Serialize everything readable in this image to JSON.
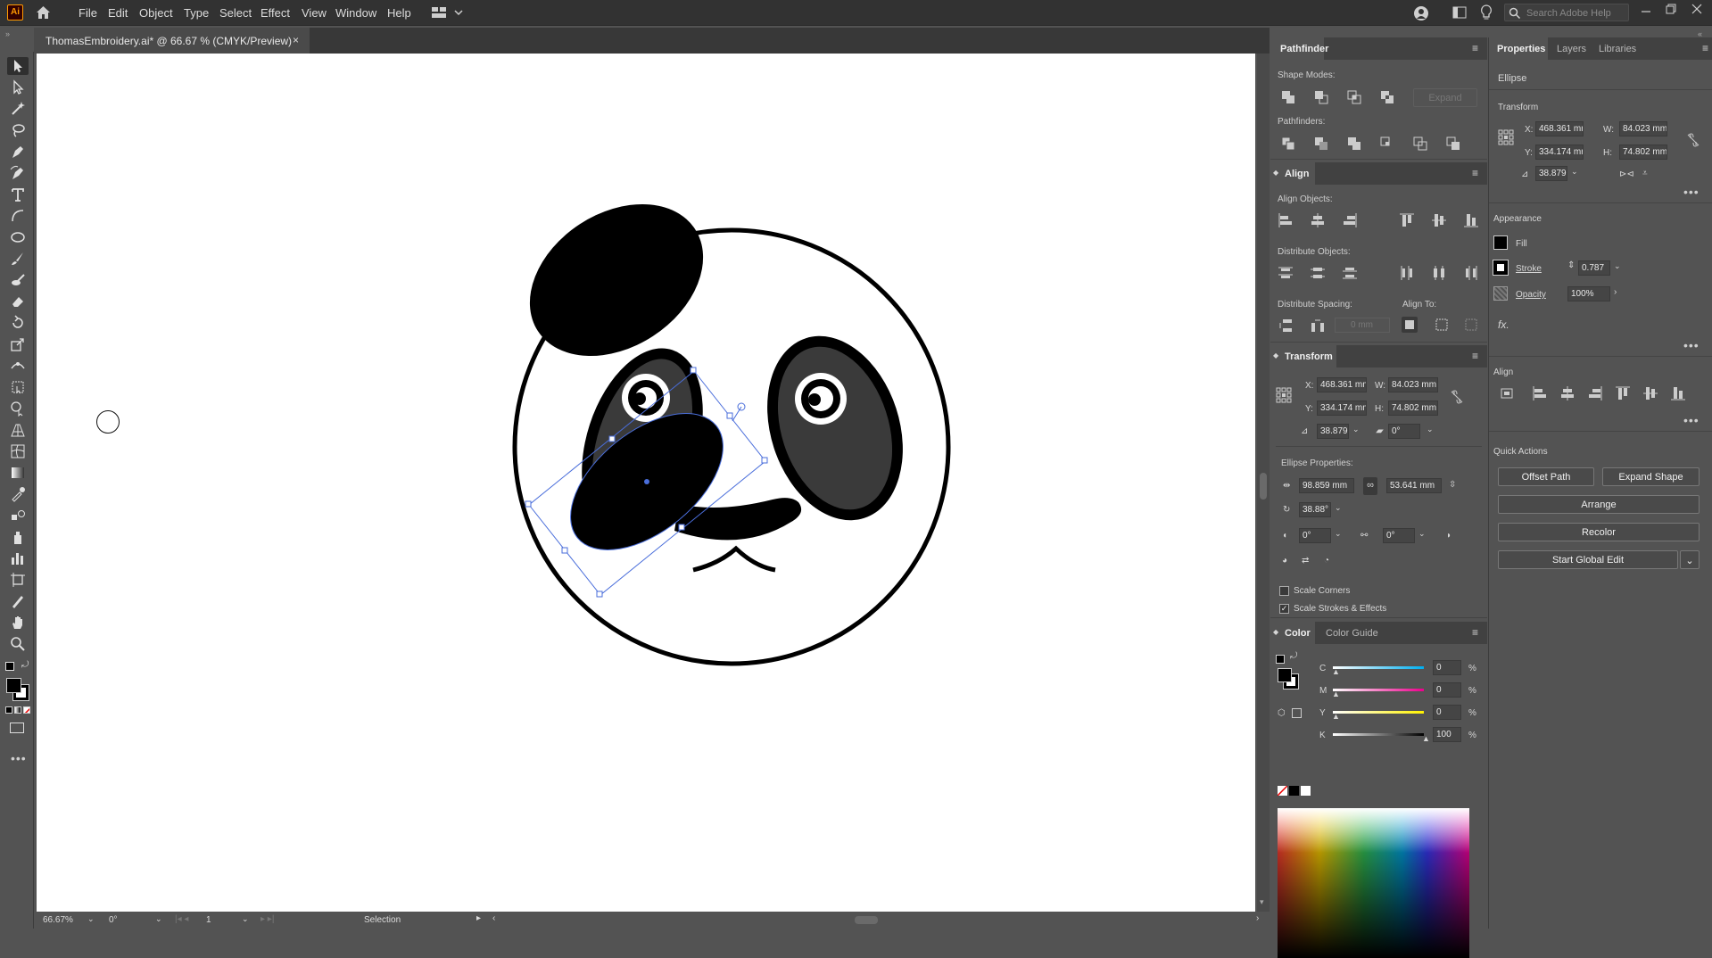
{
  "app": {
    "logo": "Ai",
    "brand_color": "#310000",
    "accent_color": "#ff9a00"
  },
  "menu": [
    "File",
    "Edit",
    "Object",
    "Type",
    "Select",
    "Effect",
    "View",
    "Window",
    "Help"
  ],
  "search": {
    "placeholder": "Search Adobe Help"
  },
  "document": {
    "tab_title": "ThomasEmbroidery.ai* @ 66.67 % (CMYK/Preview)"
  },
  "status": {
    "zoom": "66.67%",
    "rotation": "0°",
    "artboard": "1",
    "tool": "Selection"
  },
  "pathfinder": {
    "title": "Pathfinder",
    "shape_modes": "Shape Modes:",
    "expand": "Expand",
    "pathfinders": "Pathfinders:"
  },
  "align": {
    "title": "Align",
    "align_objects": "Align Objects:",
    "distribute_objects": "Distribute Objects:",
    "distribute_spacing": "Distribute Spacing:",
    "align_to": "Align To:",
    "spacing_value": "0 mm"
  },
  "transform": {
    "title": "Transform",
    "x_label": "X:",
    "x": "468.361 mm",
    "y_label": "Y:",
    "y": "334.174 mm",
    "w_label": "W:",
    "w": "84.023 mm",
    "h_label": "H:",
    "h": "74.802 mm",
    "angle": "38.879°",
    "shear": "0°",
    "ellipse_properties": "Ellipse Properties:",
    "ellipse_w": "98.859 mm",
    "ellipse_h": "53.641 mm",
    "ellipse_angle": "38.88°",
    "pie_start": "0°",
    "pie_end": "0°",
    "scale_corners": "Scale Corners",
    "scale_strokes": "Scale Strokes & Effects",
    "scale_corners_checked": false,
    "scale_strokes_checked": true
  },
  "color": {
    "title": "Color",
    "guide": "Color Guide",
    "channels": [
      {
        "label": "C",
        "value": "0"
      },
      {
        "label": "M",
        "value": "0"
      },
      {
        "label": "Y",
        "value": "0"
      },
      {
        "label": "K",
        "value": "100"
      }
    ],
    "unit": "%"
  },
  "properties": {
    "tabs": [
      "Properties",
      "Layers",
      "Libraries"
    ],
    "object_type": "Ellipse",
    "transform_title": "Transform",
    "x": "468.361 mr",
    "y": "334.174 mr",
    "w": "84.023 mm",
    "h": "74.802 mm",
    "angle": "38.879°",
    "appearance_title": "Appearance",
    "fill_label": "Fill",
    "stroke_label": "Stroke",
    "stroke_value": "0.787",
    "opacity_label": "Opacity",
    "opacity_value": "100%",
    "fx_label": "fx.",
    "align_title": "Align",
    "quick_actions_title": "Quick Actions",
    "offset_path": "Offset Path",
    "expand_shape": "Expand Shape",
    "arrange": "Arrange",
    "recolor": "Recolor",
    "global_edit": "Start Global Edit"
  },
  "tools": [
    "selection-tool",
    "direct-selection-tool",
    "magic-wand-tool",
    "lasso-tool",
    "pen-tool",
    "curvature-tool",
    "type-tool",
    "line-tool",
    "ellipse-tool",
    "paintbrush-tool",
    "blob-brush-tool",
    "eraser-tool",
    "rotate-tool",
    "scale-tool",
    "width-tool",
    "free-transform-tool",
    "shape-builder-tool",
    "perspective-grid-tool",
    "mesh-tool",
    "gradient-tool",
    "eyedropper-tool",
    "blend-tool",
    "symbol-sprayer-tool",
    "column-graph-tool",
    "artboard-tool",
    "slice-tool",
    "hand-tool",
    "zoom-tool"
  ]
}
